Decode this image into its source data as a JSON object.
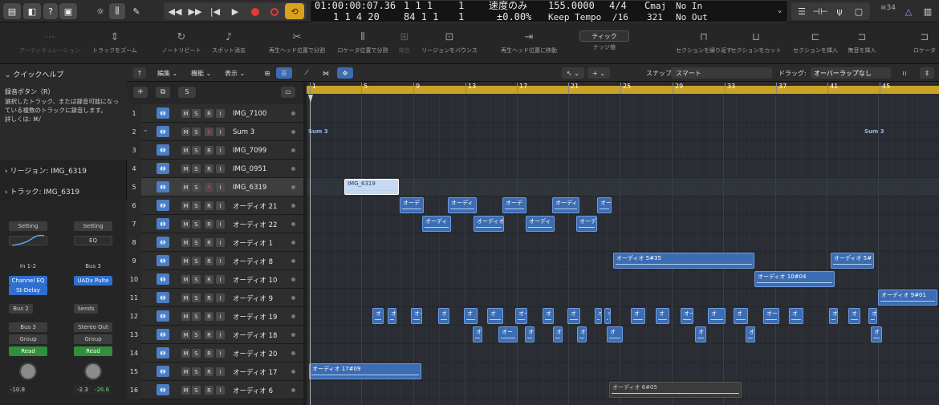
{
  "lcd": {
    "timecode": "01:00:00:07.36",
    "pos_top": "1  1  1",
    "pos_top_sub": "1",
    "bars": "1  1  4  20",
    "pos2": "84  1  1",
    "pos2_sub": "1",
    "mode_top": "速度のみ",
    "mode_bottom": "±0.00",
    "mode_bottom_unit": "%",
    "tempo": "155.0000",
    "tempo_mode": "Keep Tempo",
    "sig": "4/4",
    "division": "/16",
    "key": "C",
    "key_mode": "maj",
    "key_sub": "321",
    "in_label": "No In",
    "out_label": "No Out"
  },
  "topright": {
    "count": "≡34"
  },
  "toolbar": [
    {
      "label": "アーティキュレーション",
      "icon": "⋯",
      "dim": true
    },
    {
      "label": "トラックをズーム",
      "icon": "⇕"
    },
    {
      "label": "ノートリピート",
      "icon": "↻"
    },
    {
      "label": "スポット消去",
      "icon": "♪"
    },
    {
      "label": "再生ヘッド位置で分割",
      "icon": "✂"
    },
    {
      "label": "ロケータ位置で分割",
      "icon": "⫴"
    },
    {
      "label": "結合",
      "icon": "⊞",
      "dim": true
    },
    {
      "label": "リージョンをバウンス",
      "icon": "⊡"
    },
    {
      "label": "再生ヘッド位置に移動",
      "icon": "⇥"
    },
    {
      "label": "ナッジ値",
      "icon": "ティック"
    },
    {
      "label": "セクションを繰り返す",
      "icon": "⊓"
    },
    {
      "label": "セクションをカット",
      "icon": "⊔"
    },
    {
      "label": "セクションを挿入",
      "icon": "⊏"
    },
    {
      "label": "無音を挿入",
      "icon": "⊐"
    },
    {
      "label": "ロケータ",
      "icon": "⊐"
    }
  ],
  "quickhelp": {
    "title": "クイックヘルプ",
    "heading": "録音ボタン（R）",
    "body1": "選択したトラック、または録音可能になっ",
    "body2": "ている複数のトラックに録音します。",
    "body3": "詳しくは: ⌘/"
  },
  "inspector": {
    "region": "リージョン: IMG_6319",
    "track": "トラック: IMG_6319"
  },
  "strips": [
    {
      "setting": "Setting",
      "input": "In 1-2",
      "fx1": "Channel EQ",
      "fx2": "St-Delay",
      "send": "Bus 2",
      "output": "Bus 3",
      "group": "Group",
      "auto": "Read",
      "vol": "-10.8",
      "peak": ""
    },
    {
      "setting": "Setting",
      "eq": "EQ",
      "input": "Bus 3",
      "fx1": "UADx Pulte",
      "fx2": "",
      "send": "Sends",
      "output": "Stereo Out",
      "group": "Group",
      "auto": "Read",
      "vol": "-2.3",
      "peak": "-26.6"
    }
  ],
  "arrange": {
    "menus": [
      "編集",
      "機能",
      "表示"
    ],
    "snap_label": "スナップ:",
    "snap_value": "スマート",
    "drag_label": "ドラッグ:",
    "drag_value": "オーバーラップなし",
    "s_button": "S"
  },
  "bars": [
    "1",
    "5",
    "9",
    "13",
    "17",
    "21",
    "25",
    "29",
    "33",
    "37",
    "41",
    "45"
  ],
  "tracks": [
    {
      "num": "1",
      "name": "IMG_7100",
      "m": "M",
      "s": "S",
      "r": "R",
      "i": "I"
    },
    {
      "num": "2",
      "name": "Sum 3",
      "m": "M",
      "s": "S",
      "r": "R",
      "i": "I"
    },
    {
      "num": "3",
      "name": "IMG_7099",
      "m": "M",
      "s": "S",
      "r": "R",
      "i": "I"
    },
    {
      "num": "4",
      "name": "IMG_0951",
      "m": "M",
      "s": "S",
      "r": "R",
      "i": "I"
    },
    {
      "num": "5",
      "name": "IMG_6319",
      "m": "M",
      "s": "S",
      "r": "R",
      "i": "I"
    },
    {
      "num": "6",
      "name": "オーディオ 21",
      "m": "M",
      "s": "S",
      "r": "R",
      "i": "I"
    },
    {
      "num": "7",
      "name": "オーディオ 22",
      "m": "M",
      "s": "S",
      "r": "R",
      "i": "I"
    },
    {
      "num": "8",
      "name": "オーディオ 1",
      "m": "M",
      "s": "S",
      "r": "R",
      "i": "I"
    },
    {
      "num": "9",
      "name": "オーディオ 8",
      "m": "M",
      "s": "S",
      "r": "R",
      "i": "I"
    },
    {
      "num": "10",
      "name": "オーディオ 10",
      "m": "M",
      "s": "S",
      "r": "R",
      "i": "I"
    },
    {
      "num": "11",
      "name": "オーディオ 9",
      "m": "M",
      "s": "S",
      "r": "R",
      "i": "I"
    },
    {
      "num": "12",
      "name": "オーディオ 19",
      "m": "M",
      "s": "S",
      "r": "R",
      "i": "I"
    },
    {
      "num": "13",
      "name": "オーディオ 18",
      "m": "M",
      "s": "S",
      "r": "R",
      "i": "I"
    },
    {
      "num": "14",
      "name": "オーディオ 20",
      "m": "M",
      "s": "S",
      "r": "R",
      "i": "I"
    },
    {
      "num": "15",
      "name": "オーディオ 17",
      "m": "M",
      "s": "S",
      "r": "R",
      "i": "I"
    },
    {
      "num": "16",
      "name": "オーディオ 6",
      "m": "M",
      "s": "S",
      "r": "R",
      "i": "I"
    }
  ],
  "sum_labels": [
    "Sum 3",
    "Sum 3"
  ],
  "regions": {
    "img6319": "IMG_6319",
    "t6": [
      "オーデ",
      "オーディ",
      "オーデ",
      "オーディ",
      "オー"
    ],
    "t7": [
      "オーディ",
      "オーディオ",
      "オーディ",
      "オーデ"
    ],
    "t9a": "オーディオ 5#35",
    "t9b": "オーディオ 5#",
    "t10": "オーディオ 10#04",
    "t11": "オーディオ 9#01",
    "t12": [
      "オ",
      "オ",
      "オー",
      "オ",
      "オ",
      "オ",
      "オー",
      "オ",
      "オ",
      "オ",
      "オー",
      "オ",
      "オ",
      "オー",
      "オ",
      "オ",
      "オーディ",
      "オ",
      "オ",
      "オ",
      "オ"
    ],
    "t13": [
      "オ",
      "オー",
      "オ",
      "オ",
      "オ",
      "オ",
      "オ",
      "オ",
      "オ"
    ],
    "t15": "オーディオ 17#09",
    "t16": "オーディオ 6#05"
  }
}
